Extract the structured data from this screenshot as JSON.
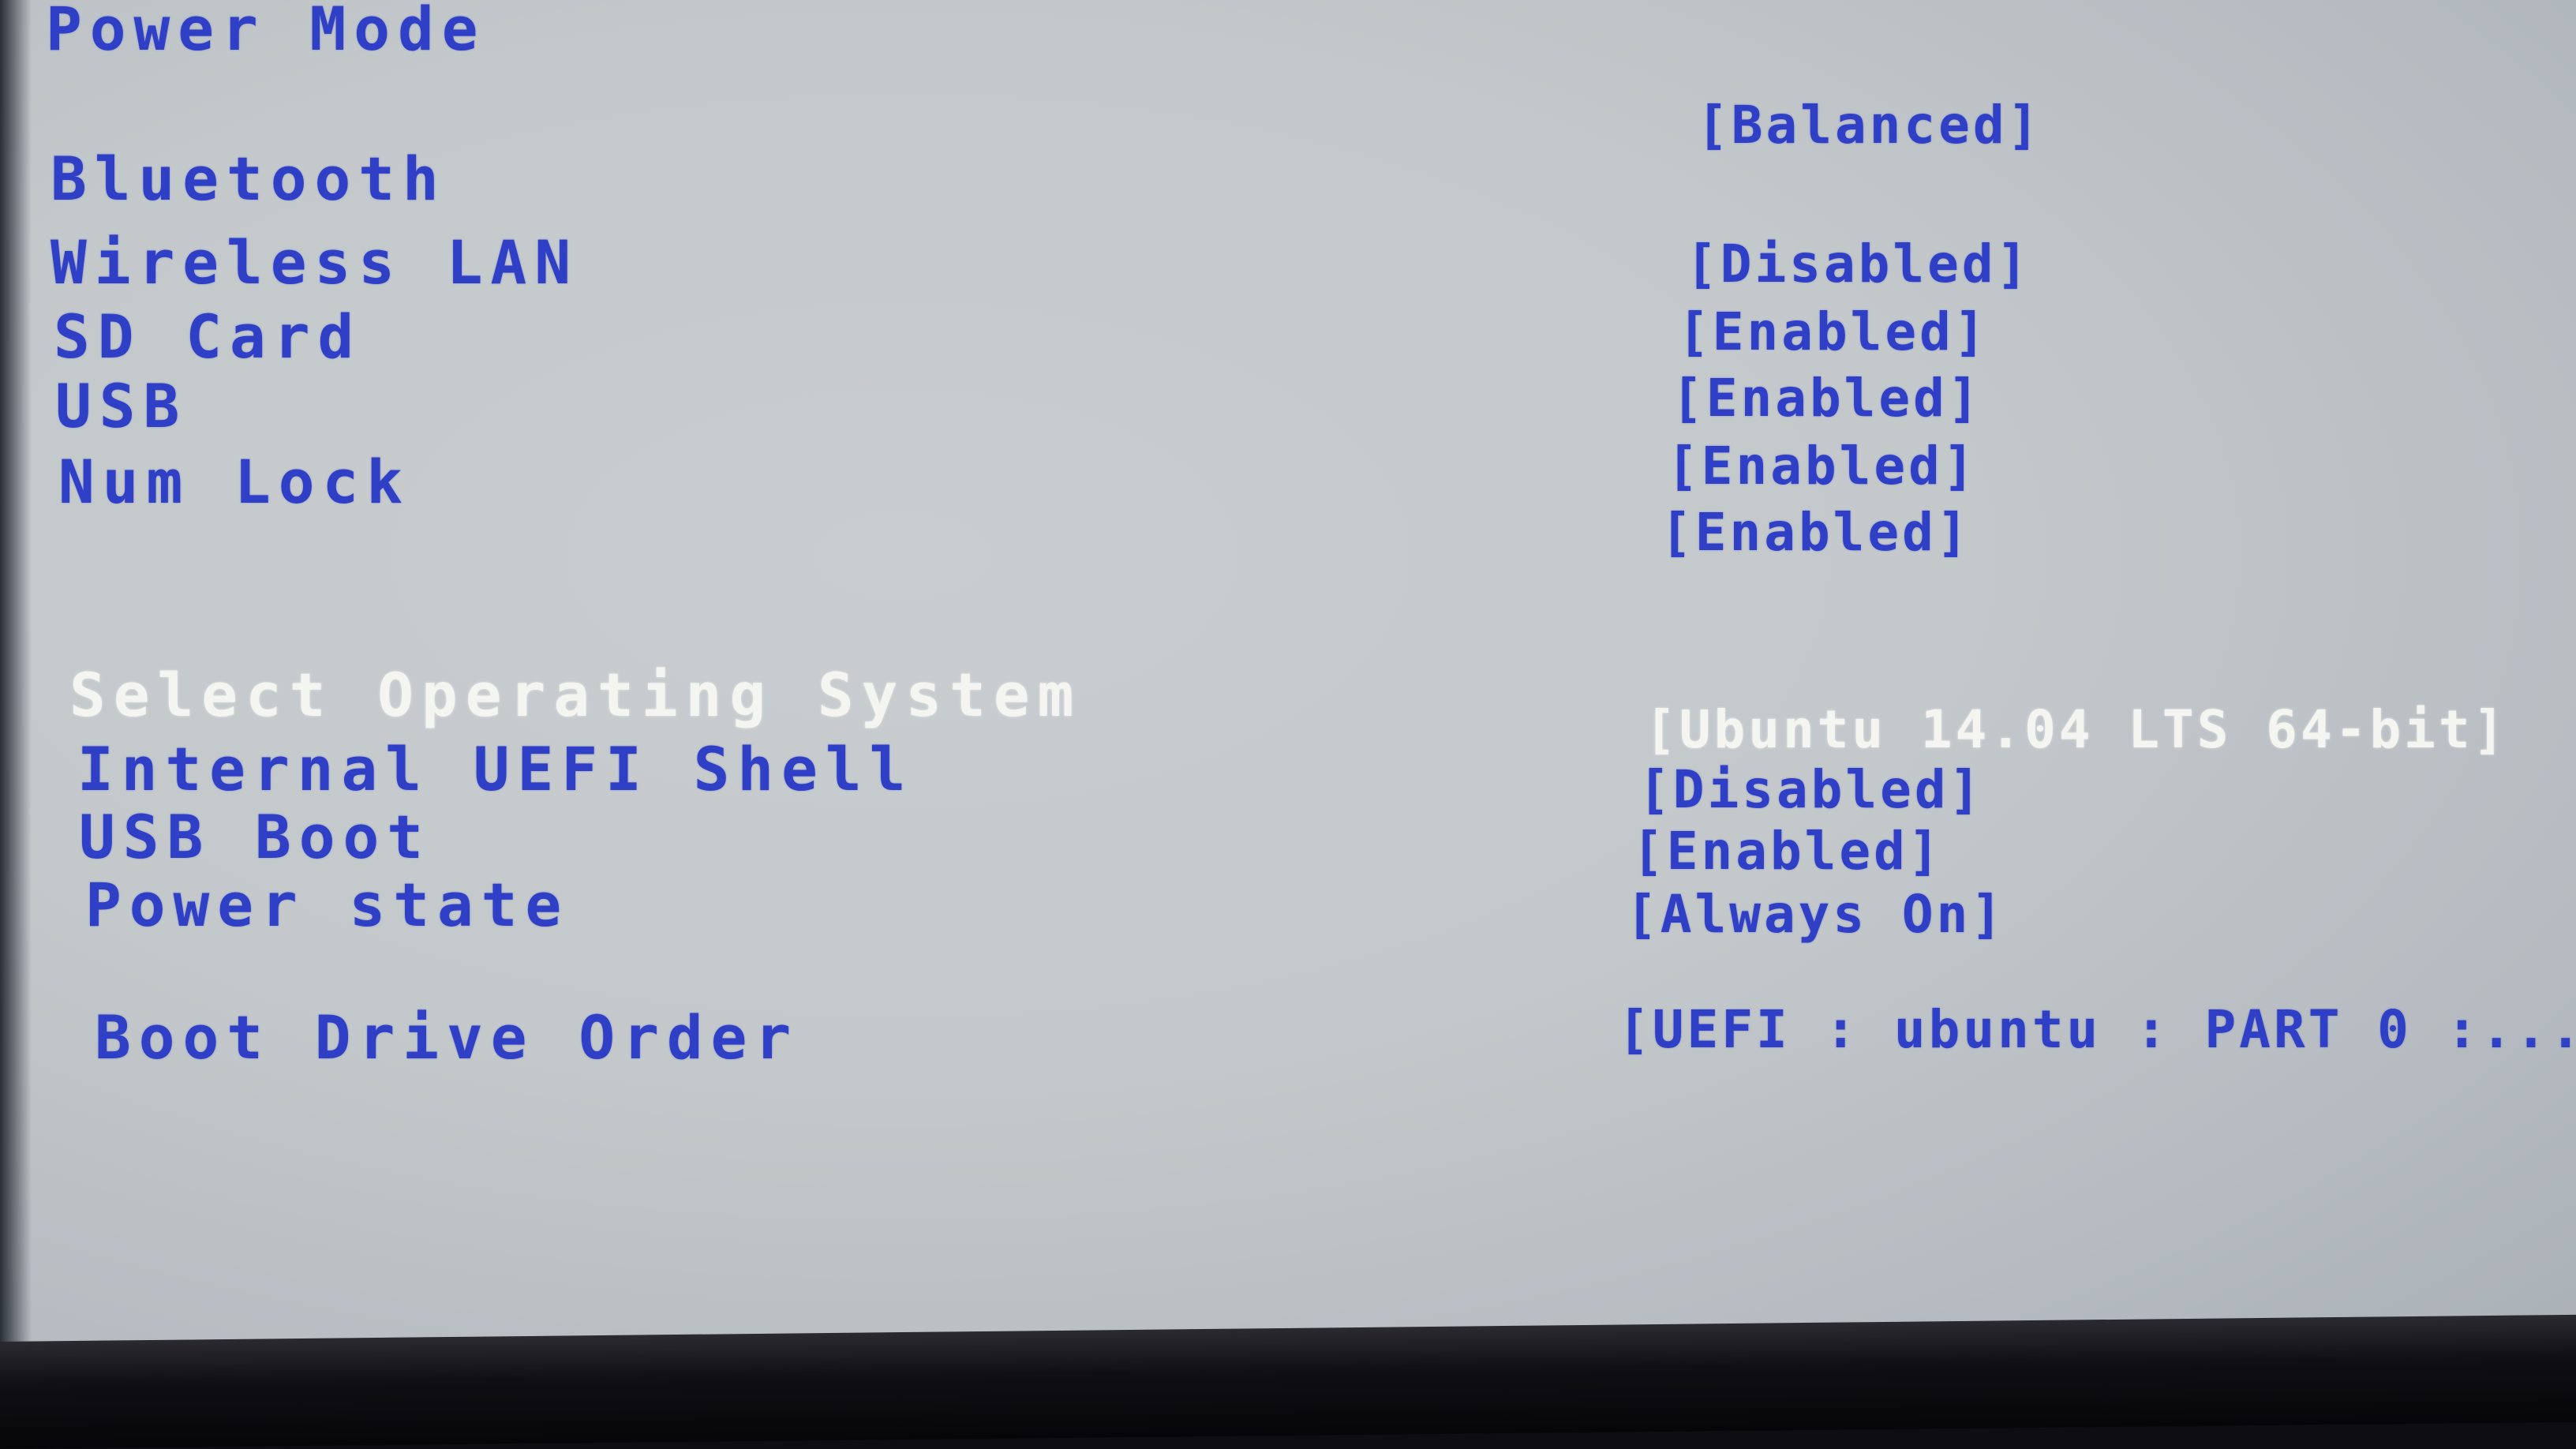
{
  "settings": [
    {
      "label": "Power Mode",
      "value": "[Balanced]"
    },
    {
      "label": "Bluetooth",
      "value": ""
    },
    {
      "label": "Wireless LAN",
      "value": "[Disabled]"
    },
    {
      "label": "SD Card",
      "value": "[Enabled]"
    },
    {
      "label": "USB",
      "value": "[Enabled]"
    },
    {
      "label": "Num Lock",
      "value": "[Enabled]"
    },
    {
      "label": "",
      "value": "[Enabled]"
    },
    {
      "label": "Select Operating System",
      "value": "[Ubuntu 14.04 LTS 64-bit]"
    },
    {
      "label": "Internal UEFI Shell",
      "value": "[Disabled]"
    },
    {
      "label": "USB Boot",
      "value": "[Enabled]"
    },
    {
      "label": "Power state",
      "value": "[Always On]"
    },
    {
      "label": "Boot Drive Order",
      "value": "[UEFI : ubuntu : PART 0 :...]"
    }
  ],
  "colors": {
    "text": "#2f3fc6",
    "selected_text": "#f4f4f0",
    "background": "#c5c9cc"
  }
}
